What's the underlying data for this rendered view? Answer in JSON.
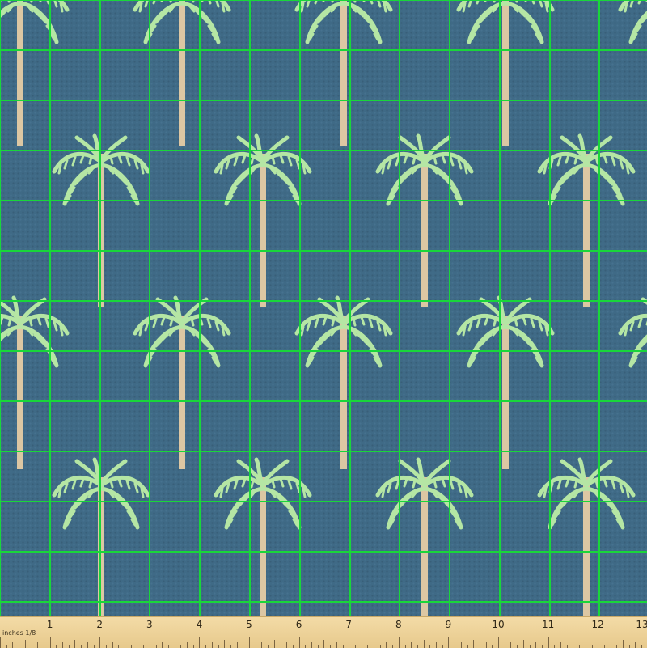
{
  "ruler": {
    "unit_label": "inches 1/8",
    "numbers": [
      "1",
      "2",
      "3",
      "4",
      "5",
      "6",
      "7",
      "8",
      "9",
      "10",
      "11",
      "12",
      "13"
    ]
  },
  "colors": {
    "background": "#3f6a86",
    "grid_lines": "#19d63a",
    "frond": "#b5e6a4",
    "trunk": "#dcc7a3",
    "ruler": "#f0d69f"
  },
  "pattern": {
    "motif": "palm-tree-icon",
    "grid": "green-grid"
  }
}
